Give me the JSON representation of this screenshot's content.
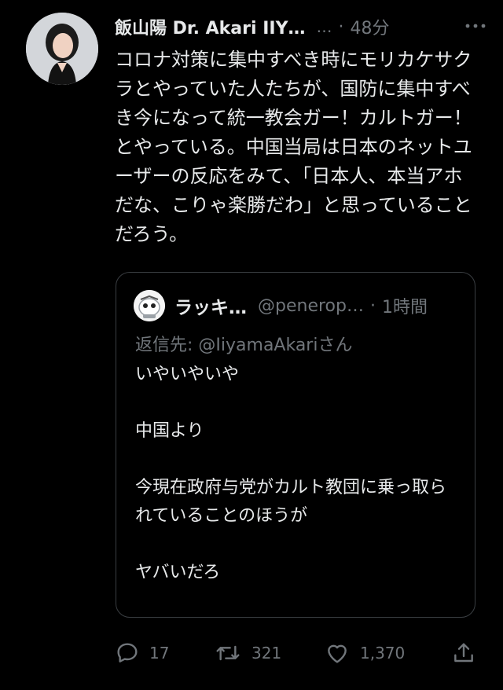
{
  "tweet": {
    "author_name": "飯山陽 Dr. Akari IIY…",
    "handle_truncated": "…",
    "separator": "·",
    "time": "48分",
    "text": "コロナ対策に集中すべき時にモリカケサクラとやっていた人たちが、国防に集中すべき今になって統一教会ガー！カルトガー！とやっている。中国当局は日本のネットユーザーの反応をみて、「日本人、本当アホだな、こりゃ楽勝だわ」と思っていることだろう。",
    "more_icon": "more-icon"
  },
  "quote": {
    "author_name": "ラッキ…",
    "handle": "@penerop…",
    "separator": "·",
    "time": "1時間",
    "reply_prefix": "返信先: ",
    "reply_mention": "@IiyamaAkari",
    "reply_suffix": "さん",
    "text": "いやいやいや\n\n中国より\n\n今現在政府与党がカルト教団に乗っ取られていることのほうが\n\nヤバいだろ"
  },
  "actions": {
    "reply_count": "17",
    "retweet_count": "321",
    "like_count": "1,370"
  },
  "colors": {
    "background": "#000000",
    "text": "#e7e9ea",
    "secondary": "#71767b",
    "border": "#3a3e42"
  }
}
